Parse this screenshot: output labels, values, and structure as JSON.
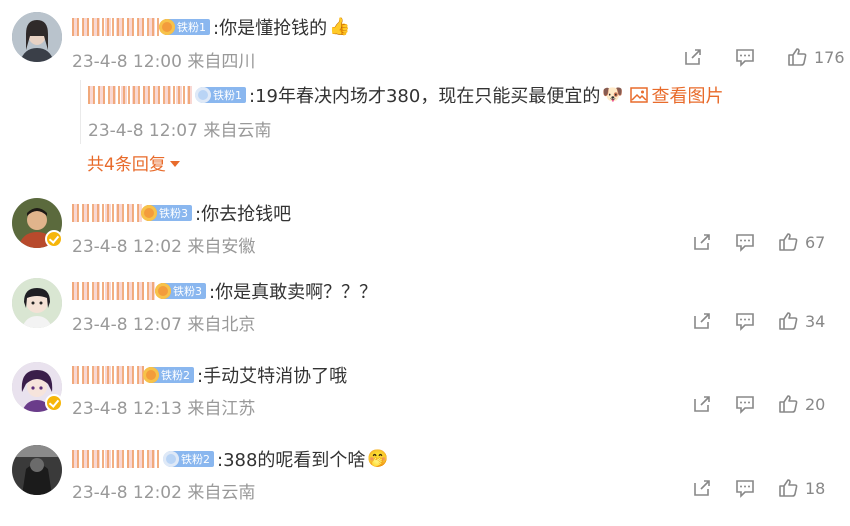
{
  "colors": {
    "accent": "#e86b2b",
    "meta": "#999999",
    "fan_badge": "#8ab7ef"
  },
  "comments": [
    {
      "badge": "铁粉1",
      "text": ":你是懂抢钱的",
      "emoji": "👍",
      "meta": "23-4-8 12:00 来自四川",
      "likes": "176",
      "reply": {
        "badge": "铁粉1",
        "text": ":19年春决内场才380，现在只能买最便宜的",
        "emoji": "🐶",
        "link": "查看图片",
        "meta": "23-4-8 12:07 来自云南"
      },
      "more": "共4条回复"
    },
    {
      "badge": "铁粉3",
      "text": ":你去抢钱吧",
      "meta": "23-4-8 12:02 来自安徽",
      "likes": "67"
    },
    {
      "badge": "铁粉3",
      "text": ":你是真敢卖啊？？？",
      "meta": "23-4-8 12:07 来自北京",
      "likes": "34"
    },
    {
      "badge": "铁粉2",
      "text": ":手动艾特消协了哦",
      "meta": "23-4-8 12:13 来自江苏",
      "likes": "20"
    },
    {
      "badge": "铁粉2",
      "text": ":388的呢看到个啥",
      "emoji": "🤭",
      "meta": "23-4-8 12:02 来自云南",
      "likes": "18"
    }
  ],
  "icons": [
    "share-icon",
    "comment-icon",
    "like-icon",
    "image-icon",
    "verified-icon"
  ]
}
